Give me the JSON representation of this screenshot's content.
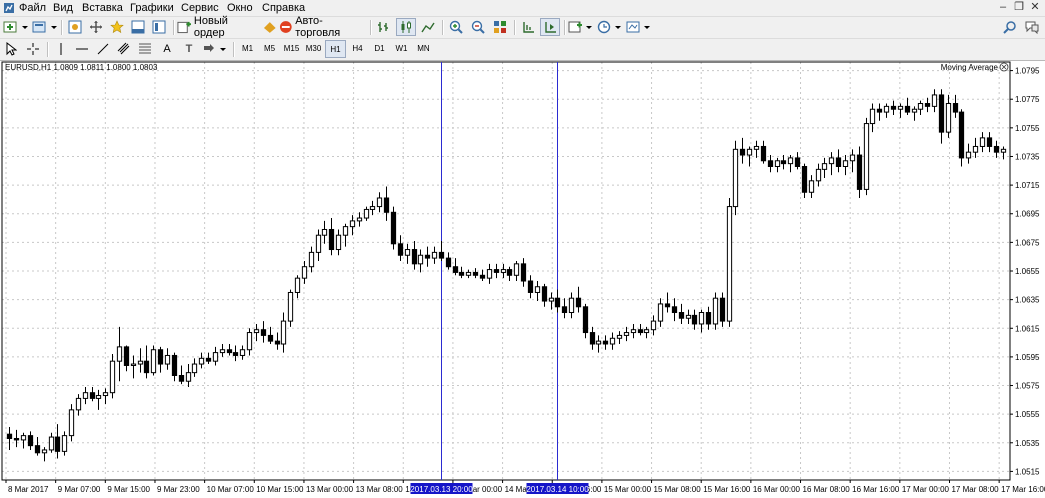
{
  "menu": [
    "Файл",
    "Вид",
    "Вставка",
    "Графики",
    "Сервис",
    "Окно",
    "Справка"
  ],
  "window_controls": {
    "minimize": "–",
    "restore": "❐",
    "close": "✕"
  },
  "toolbar": {
    "new_order": "Новый ордер",
    "auto_trading": "Авто-торговля"
  },
  "drawing_tools": {
    "text": "A",
    "label": "T"
  },
  "timeframes": [
    "M1",
    "M5",
    "M15",
    "M30",
    "H1",
    "H4",
    "D1",
    "W1",
    "MN"
  ],
  "active_timeframe": "H1",
  "chart": {
    "info": "EURUSD,H1  1.0809 1.0811 1.0800 1.0803",
    "indicator": "Moving Average",
    "price_labels": [
      "1.0795",
      "1.0775",
      "1.0755",
      "1.0735",
      "1.0715",
      "1.0695",
      "1.0675",
      "1.0655",
      "1.0635",
      "1.0615",
      "1.0595",
      "1.0575",
      "1.0555",
      "1.0535",
      "1.0515"
    ],
    "time_labels": [
      "8 Mar 2017",
      "9 Mar 07:00",
      "9 Mar 15:00",
      "9 Mar 23:00",
      "10 Mar 07:00",
      "10 Mar 15:00",
      "13 Mar 00:00",
      "13 Mar 08:00",
      "13 Mar 16:00",
      "14 Mar 00:00",
      "14 Mar 08:00",
      "14 Mar 16:00",
      "15 Mar 00:00",
      "15 Mar 08:00",
      "15 Mar 16:00",
      "16 Mar 00:00",
      "16 Mar 08:00",
      "16 Mar 16:00",
      "17 Mar 00:00",
      "17 Mar 08:00",
      "17 Mar 16:00"
    ],
    "markers": [
      "2017.03.13 20:00",
      "2017.03.14 10:00"
    ],
    "colors": {
      "marker_line": "#2b2bd1",
      "marker_label_bg": "#1515c8",
      "bull_fill": "#ffffff",
      "bear_fill": "#000000"
    }
  },
  "chart_data": {
    "type": "candlestick",
    "symbol": "EURUSD",
    "timeframe": "H1",
    "ylim": [
      1.0509,
      1.0801
    ],
    "ohlc": [
      [
        1.0541,
        1.0546,
        1.053,
        1.0538
      ],
      [
        1.0538,
        1.0544,
        1.0532,
        1.0537
      ],
      [
        1.0537,
        1.0542,
        1.0531,
        1.054
      ],
      [
        1.054,
        1.0543,
        1.053,
        1.0533
      ],
      [
        1.0533,
        1.0539,
        1.0526,
        1.0528
      ],
      [
        1.0528,
        1.0532,
        1.0522,
        1.053
      ],
      [
        1.053,
        1.0542,
        1.0528,
        1.0539
      ],
      [
        1.0539,
        1.0548,
        1.0524,
        1.0529
      ],
      [
        1.0529,
        1.0543,
        1.0526,
        1.054
      ],
      [
        1.054,
        1.0562,
        1.0536,
        1.0558
      ],
      [
        1.0558,
        1.0569,
        1.0554,
        1.0566
      ],
      [
        1.0566,
        1.0574,
        1.0562,
        1.057
      ],
      [
        1.057,
        1.0574,
        1.0564,
        1.0566
      ],
      [
        1.0566,
        1.0572,
        1.0558,
        1.0568
      ],
      [
        1.0568,
        1.0573,
        1.0562,
        1.057
      ],
      [
        1.057,
        1.0597,
        1.0566,
        1.0592
      ],
      [
        1.0592,
        1.0616,
        1.0578,
        1.0602
      ],
      [
        1.0602,
        1.0603,
        1.0585,
        1.0589
      ],
      [
        1.0589,
        1.0596,
        1.058,
        1.059
      ],
      [
        1.059,
        1.0601,
        1.0584,
        1.0592
      ],
      [
        1.0592,
        1.0603,
        1.058,
        1.0584
      ],
      [
        1.0584,
        1.0603,
        1.0582,
        1.06
      ],
      [
        1.06,
        1.0602,
        1.0584,
        1.059
      ],
      [
        1.059,
        1.0601,
        1.0586,
        1.0596
      ],
      [
        1.0596,
        1.0598,
        1.0578,
        1.0582
      ],
      [
        1.0582,
        1.0589,
        1.0576,
        1.0578
      ],
      [
        1.0578,
        1.059,
        1.0574,
        1.0584
      ],
      [
        1.0584,
        1.0594,
        1.0581,
        1.059
      ],
      [
        1.059,
        1.0598,
        1.0587,
        1.0594
      ],
      [
        1.0594,
        1.0598,
        1.059,
        1.0592
      ],
      [
        1.0592,
        1.0602,
        1.0589,
        1.0598
      ],
      [
        1.0598,
        1.0604,
        1.0595,
        1.06
      ],
      [
        1.06,
        1.0604,
        1.0596,
        1.0598
      ],
      [
        1.0598,
        1.0603,
        1.0592,
        1.0596
      ],
      [
        1.0596,
        1.0603,
        1.0593,
        1.06
      ],
      [
        1.06,
        1.0615,
        1.0596,
        1.0612
      ],
      [
        1.0612,
        1.0618,
        1.0606,
        1.0614
      ],
      [
        1.0614,
        1.062,
        1.0605,
        1.061
      ],
      [
        1.061,
        1.0616,
        1.0604,
        1.0606
      ],
      [
        1.0606,
        1.0612,
        1.06,
        1.0604
      ],
      [
        1.0604,
        1.0626,
        1.0598,
        1.062
      ],
      [
        1.062,
        1.0642,
        1.0616,
        1.064
      ],
      [
        1.064,
        1.0652,
        1.0636,
        1.065
      ],
      [
        1.065,
        1.0662,
        1.0646,
        1.0658
      ],
      [
        1.0658,
        1.0672,
        1.0654,
        1.0668
      ],
      [
        1.0668,
        1.0684,
        1.0662,
        1.068
      ],
      [
        1.068,
        1.069,
        1.0674,
        1.0684
      ],
      [
        1.0684,
        1.0692,
        1.0666,
        1.067
      ],
      [
        1.067,
        1.0684,
        1.0666,
        1.068
      ],
      [
        1.068,
        1.0688,
        1.0672,
        1.0686
      ],
      [
        1.0686,
        1.0694,
        1.068,
        1.069
      ],
      [
        1.069,
        1.0696,
        1.0686,
        1.0692
      ],
      [
        1.0692,
        1.07,
        1.069,
        1.0698
      ],
      [
        1.0698,
        1.0704,
        1.0694,
        1.07
      ],
      [
        1.07,
        1.071,
        1.0696,
        1.0706
      ],
      [
        1.0706,
        1.0714,
        1.069,
        1.0696
      ],
      [
        1.0696,
        1.07,
        1.067,
        1.0674
      ],
      [
        1.0674,
        1.068,
        1.0662,
        1.0666
      ],
      [
        1.0666,
        1.0674,
        1.066,
        1.067
      ],
      [
        1.067,
        1.0676,
        1.0656,
        1.066
      ],
      [
        1.066,
        1.067,
        1.0654,
        1.0666
      ],
      [
        1.0666,
        1.0672,
        1.0658,
        1.0664
      ],
      [
        1.0664,
        1.0672,
        1.066,
        1.0668
      ],
      [
        1.0668,
        1.0676,
        1.0662,
        1.0664
      ],
      [
        1.0664,
        1.0668,
        1.0656,
        1.0658
      ],
      [
        1.0658,
        1.0664,
        1.0652,
        1.0654
      ],
      [
        1.0654,
        1.0658,
        1.065,
        1.0652
      ],
      [
        1.0652,
        1.0656,
        1.065,
        1.0654
      ],
      [
        1.0654,
        1.0657,
        1.065,
        1.0652
      ],
      [
        1.0652,
        1.0656,
        1.0648,
        1.065
      ],
      [
        1.065,
        1.066,
        1.0646,
        1.0656
      ],
      [
        1.0656,
        1.066,
        1.065,
        1.0654
      ],
      [
        1.0654,
        1.066,
        1.065,
        1.0656
      ],
      [
        1.0656,
        1.0658,
        1.0648,
        1.0652
      ],
      [
        1.0652,
        1.0662,
        1.0648,
        1.066
      ],
      [
        1.066,
        1.0664,
        1.0644,
        1.0648
      ],
      [
        1.0648,
        1.0652,
        1.0636,
        1.064
      ],
      [
        1.064,
        1.0648,
        1.0634,
        1.0644
      ],
      [
        1.0644,
        1.0646,
        1.063,
        1.0634
      ],
      [
        1.0634,
        1.064,
        1.0628,
        1.0636
      ],
      [
        1.0636,
        1.0642,
        1.0626,
        1.063
      ],
      [
        1.063,
        1.0636,
        1.0622,
        1.0626
      ],
      [
        1.0626,
        1.064,
        1.0622,
        1.0636
      ],
      [
        1.0636,
        1.0644,
        1.0626,
        1.063
      ],
      [
        1.063,
        1.0632,
        1.0608,
        1.0612
      ],
      [
        1.0612,
        1.0616,
        1.06,
        1.0604
      ],
      [
        1.0604,
        1.061,
        1.0598,
        1.0606
      ],
      [
        1.0606,
        1.061,
        1.06,
        1.0604
      ],
      [
        1.0604,
        1.0612,
        1.06,
        1.0608
      ],
      [
        1.0608,
        1.0613,
        1.0604,
        1.061
      ],
      [
        1.061,
        1.0616,
        1.0606,
        1.0612
      ],
      [
        1.0612,
        1.0618,
        1.0608,
        1.0614
      ],
      [
        1.0614,
        1.0618,
        1.061,
        1.0612
      ],
      [
        1.0612,
        1.0616,
        1.0608,
        1.0614
      ],
      [
        1.0614,
        1.0624,
        1.061,
        1.062
      ],
      [
        1.062,
        1.0636,
        1.0616,
        1.0632
      ],
      [
        1.0632,
        1.064,
        1.0626,
        1.063
      ],
      [
        1.063,
        1.0636,
        1.062,
        1.0626
      ],
      [
        1.0626,
        1.0632,
        1.0618,
        1.0622
      ],
      [
        1.0622,
        1.0628,
        1.0618,
        1.0624
      ],
      [
        1.0624,
        1.0628,
        1.0614,
        1.0618
      ],
      [
        1.0618,
        1.0628,
        1.0612,
        1.0626
      ],
      [
        1.0626,
        1.063,
        1.0614,
        1.0618
      ],
      [
        1.0618,
        1.064,
        1.0614,
        1.0636
      ],
      [
        1.0636,
        1.064,
        1.0616,
        1.062
      ],
      [
        1.062,
        1.0706,
        1.0616,
        1.07
      ],
      [
        1.07,
        1.0746,
        1.0694,
        1.074
      ],
      [
        1.074,
        1.0748,
        1.073,
        1.0736
      ],
      [
        1.0736,
        1.0742,
        1.0728,
        1.074
      ],
      [
        1.074,
        1.0746,
        1.0734,
        1.0742
      ],
      [
        1.0742,
        1.0746,
        1.073,
        1.0732
      ],
      [
        1.0732,
        1.0736,
        1.0724,
        1.0728
      ],
      [
        1.0728,
        1.0734,
        1.0724,
        1.0732
      ],
      [
        1.0732,
        1.0736,
        1.0726,
        1.073
      ],
      [
        1.073,
        1.0736,
        1.0724,
        1.0734
      ],
      [
        1.0734,
        1.0738,
        1.0726,
        1.0728
      ],
      [
        1.0728,
        1.073,
        1.0706,
        1.071
      ],
      [
        1.071,
        1.0722,
        1.0706,
        1.0718
      ],
      [
        1.0718,
        1.073,
        1.0714,
        1.0726
      ],
      [
        1.0726,
        1.0734,
        1.072,
        1.073
      ],
      [
        1.073,
        1.0738,
        1.0722,
        1.0734
      ],
      [
        1.0734,
        1.074,
        1.0724,
        1.0728
      ],
      [
        1.0728,
        1.0736,
        1.0722,
        1.0732
      ],
      [
        1.0732,
        1.074,
        1.0724,
        1.0736
      ],
      [
        1.0736,
        1.0742,
        1.0706,
        1.0712
      ],
      [
        1.0712,
        1.0762,
        1.0708,
        1.0758
      ],
      [
        1.0758,
        1.0772,
        1.0752,
        1.0768
      ],
      [
        1.0768,
        1.0772,
        1.076,
        1.0766
      ],
      [
        1.0766,
        1.0772,
        1.0762,
        1.077
      ],
      [
        1.077,
        1.0774,
        1.0764,
        1.0768
      ],
      [
        1.0768,
        1.0772,
        1.0762,
        1.077
      ],
      [
        1.077,
        1.0776,
        1.0764,
        1.0766
      ],
      [
        1.0766,
        1.077,
        1.076,
        1.0768
      ],
      [
        1.0768,
        1.0774,
        1.0764,
        1.0772
      ],
      [
        1.0772,
        1.0776,
        1.0766,
        1.077
      ],
      [
        1.077,
        1.0782,
        1.0766,
        1.0778
      ],
      [
        1.0778,
        1.0782,
        1.0744,
        1.0752
      ],
      [
        1.0752,
        1.0778,
        1.0748,
        1.0772
      ],
      [
        1.0772,
        1.0778,
        1.0762,
        1.0766
      ],
      [
        1.0766,
        1.0768,
        1.0728,
        1.0734
      ],
      [
        1.0734,
        1.0744,
        1.073,
        1.0738
      ],
      [
        1.0738,
        1.0748,
        1.0734,
        1.0742
      ],
      [
        1.0742,
        1.0752,
        1.0738,
        1.0748
      ],
      [
        1.0748,
        1.0752,
        1.0738,
        1.0742
      ],
      [
        1.0742,
        1.0746,
        1.0734,
        1.0738
      ],
      [
        1.0738,
        1.0742,
        1.0733,
        1.074
      ]
    ]
  }
}
